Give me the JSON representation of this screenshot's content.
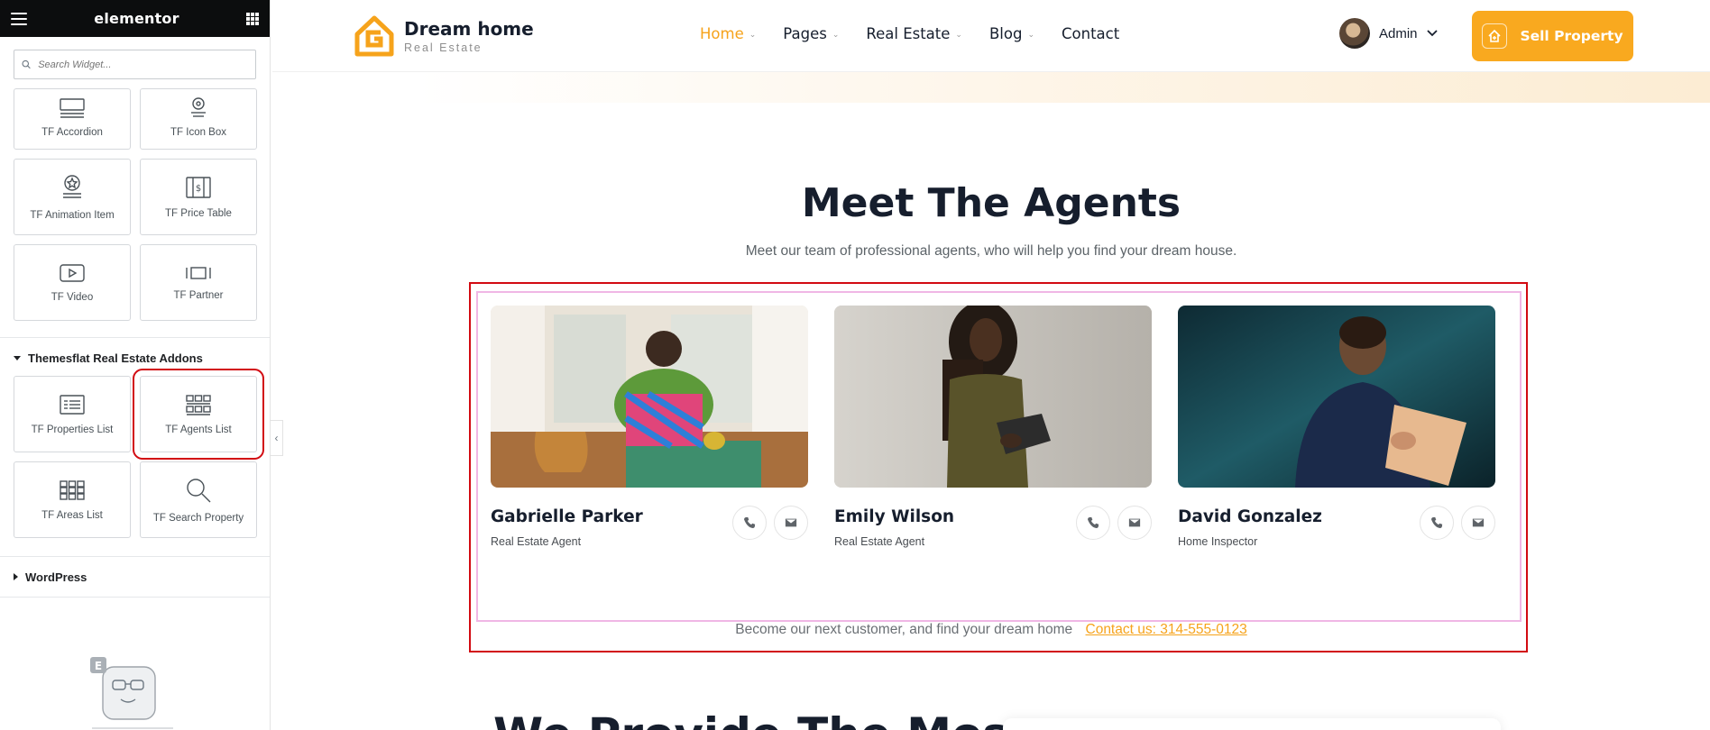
{
  "editor": {
    "brand": "elementor",
    "search_placeholder": "Search Widget...",
    "widgets_top": [
      {
        "label": "TF Accordion",
        "icon": "accordion-icon"
      },
      {
        "label": "TF Icon Box",
        "icon": "icon-box-icon"
      }
    ],
    "widgets_mid": [
      {
        "label": "TF Animation Item",
        "icon": "animation-item-icon"
      },
      {
        "label": "TF Price Table",
        "icon": "price-table-icon"
      },
      {
        "label": "TF Video",
        "icon": "video-icon"
      },
      {
        "label": "TF Partner",
        "icon": "partner-icon"
      }
    ],
    "section_addons": "Themesflat Real Estate Addons",
    "widgets_addons": [
      {
        "label": "TF Properties List",
        "icon": "properties-list-icon"
      },
      {
        "label": "TF Agents List",
        "icon": "agents-list-icon"
      },
      {
        "label": "TF Areas List",
        "icon": "areas-list-icon"
      },
      {
        "label": "TF Search Property",
        "icon": "search-property-icon"
      }
    ],
    "section_wordpress": "WordPress"
  },
  "site": {
    "logo_title": "Dream home",
    "logo_subtitle": "Real Estate",
    "nav": [
      {
        "label": "Home",
        "active": true,
        "has_dropdown": true
      },
      {
        "label": "Pages",
        "active": false,
        "has_dropdown": true
      },
      {
        "label": "Real Estate",
        "active": false,
        "has_dropdown": true
      },
      {
        "label": "Blog",
        "active": false,
        "has_dropdown": true
      },
      {
        "label": "Contact",
        "active": false,
        "has_dropdown": false
      }
    ],
    "user_name": "Admin",
    "sell_button": "Sell Property",
    "accent_color": "#f9a91f"
  },
  "section": {
    "title": "Meet The Agents",
    "subtitle": "Meet our team of professional agents, who will help you find your dream house.",
    "agents": [
      {
        "name": "Gabrielle Parker",
        "role": "Real Estate Agent"
      },
      {
        "name": "Emily Wilson",
        "role": "Real Estate Agent"
      },
      {
        "name": "David Gonzalez",
        "role": "Home Inspector"
      }
    ],
    "cta_text": "Become our next customer, and find your dream home",
    "cta_link": "Contact us: 314-555-0123"
  },
  "next_section_title": "We Provide The Most"
}
